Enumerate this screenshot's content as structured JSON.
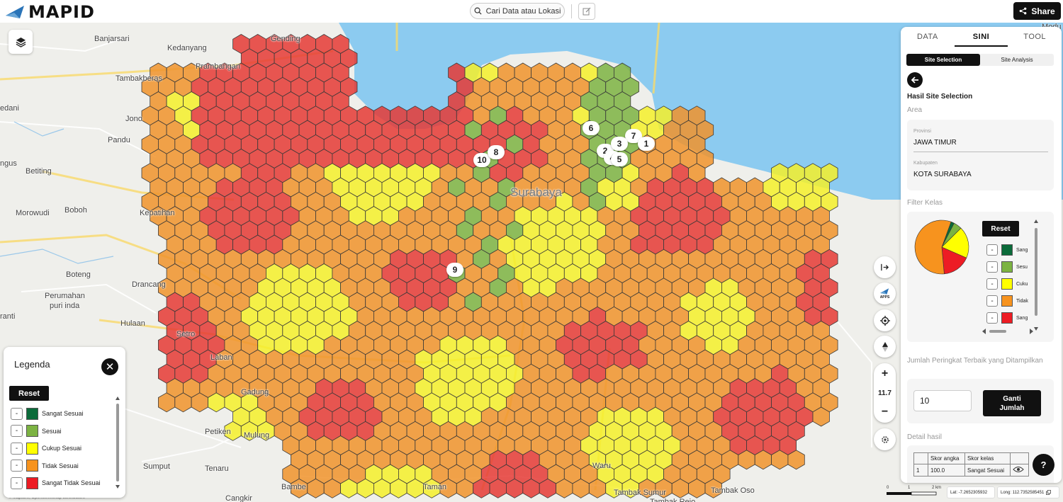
{
  "app": {
    "logo": "MAPID"
  },
  "topbar": {
    "search_label": "Cari Data atau Lokasi",
    "share_label": "Share"
  },
  "map": {
    "places": [
      {
        "name": "Banjarsari"
      },
      {
        "name": "Gending"
      },
      {
        "name": "Kedanyang"
      },
      {
        "name": "Prambangan"
      },
      {
        "name": "Tambakberas"
      },
      {
        "name": "edani"
      },
      {
        "name": "Jono"
      },
      {
        "name": "Pandu"
      },
      {
        "name": "ngus"
      },
      {
        "name": "Betiting"
      },
      {
        "name": "Morowudi"
      },
      {
        "name": "Boboh"
      },
      {
        "name": "Kepatihan"
      },
      {
        "name": "Boteng"
      },
      {
        "name": "Drancang"
      },
      {
        "name": "Perumahan"
      },
      {
        "name": "puri inda"
      },
      {
        "name": "ranti"
      },
      {
        "name": "Hulaan"
      },
      {
        "name": "Setro"
      },
      {
        "name": "Laban"
      },
      {
        "name": "Gadung"
      },
      {
        "name": "Petiken"
      },
      {
        "name": "Mulung"
      },
      {
        "name": "Sumput"
      },
      {
        "name": "Tenaru"
      },
      {
        "name": "Bambe"
      },
      {
        "name": "Cangkir"
      },
      {
        "name": "Taman"
      },
      {
        "name": "Tambak Sumur"
      },
      {
        "name": "Tambak Rejo"
      },
      {
        "name": "Tambak Oso"
      },
      {
        "name": "Waru"
      },
      {
        "name": "Modu"
      },
      {
        "name": "Surabaya"
      }
    ],
    "markers": [
      "6",
      "7",
      "2",
      "3",
      "1",
      "4",
      "5",
      "10",
      "8",
      "9"
    ],
    "zoom_level": "11.7",
    "scale": {
      "zero": "0",
      "one": "1",
      "two": "2 km"
    },
    "coords": {
      "lat": "Lat: -7.2652305932",
      "long": "Long: 112.7352585451"
    },
    "attribution": "© Maplibre, OpenStreetMap contributors",
    "colors": {
      "sangat_sesuai": "#1a6b3a",
      "sesuai": "#7cb342",
      "cukup_sesuai": "#f5f02a",
      "tidak_sesuai": "#f0932b",
      "sangat_tidak_sesuai": "#e53935",
      "water": "#8ccbf0"
    }
  },
  "legend": {
    "title": "Legenda",
    "reset_label": "Reset",
    "minus": "-",
    "items": [
      {
        "label": "Sangat Sesuai",
        "color": "#0b6b3a"
      },
      {
        "label": "Sesuai",
        "color": "#7cb342"
      },
      {
        "label": "Cukup Sesuai",
        "color": "#ffff00"
      },
      {
        "label": "Tidak Sesuai",
        "color": "#f7931e"
      },
      {
        "label": "Sangat Tidak Sesuai",
        "color": "#ed1c24"
      }
    ]
  },
  "panel": {
    "tabs": [
      "DATA",
      "SINI",
      "TOOL"
    ],
    "active_tab": "SINI",
    "subtabs": [
      "Site Selection",
      "Site Analysis"
    ],
    "heading": "Hasil Site Selection",
    "area_label": "Area",
    "provinsi_label": "Provinsi",
    "provinsi_value": "JAWA TIMUR",
    "kabupaten_label": "Kabupaten",
    "kabupaten_value": "KOTA SURABAYA",
    "filter_label": "Filter Kelas",
    "reset_label": "Reset",
    "filter_items": [
      {
        "label": "Sang",
        "color": "#0b6b3a"
      },
      {
        "label": "Sesu",
        "color": "#7cb342"
      },
      {
        "label": "Cuku",
        "color": "#ffff00"
      },
      {
        "label": "Tidak",
        "color": "#f7931e"
      },
      {
        "label": "Sang",
        "color": "#ed1c24"
      }
    ],
    "pie": [
      {
        "class": "Sangat Sesuai",
        "percent": 2,
        "color": "#0b6b3a"
      },
      {
        "class": "Sesuai",
        "percent": 5,
        "color": "#7cb342"
      },
      {
        "class": "Cukup Sesuai",
        "percent": 19,
        "color": "#ffff00"
      },
      {
        "class": "Tidak Sesuai",
        "percent": 57,
        "color": "#f7931e"
      },
      {
        "class": "Sangat Tidak Sesuai",
        "percent": 17,
        "color": "#ed1c24"
      }
    ],
    "jumlah_label": "Jumlah Peringkat Terbaik yang Ditampilkan",
    "jumlah_value": "10",
    "ganti_label": "Ganti Jumlah",
    "detail_label": "Detail hasil",
    "table": {
      "headers": [
        "",
        "Skor angka",
        "Skor kelas",
        ""
      ],
      "rows": [
        [
          "1",
          "100.0",
          "Sangat Sesuai"
        ]
      ]
    },
    "help_label": "?"
  }
}
